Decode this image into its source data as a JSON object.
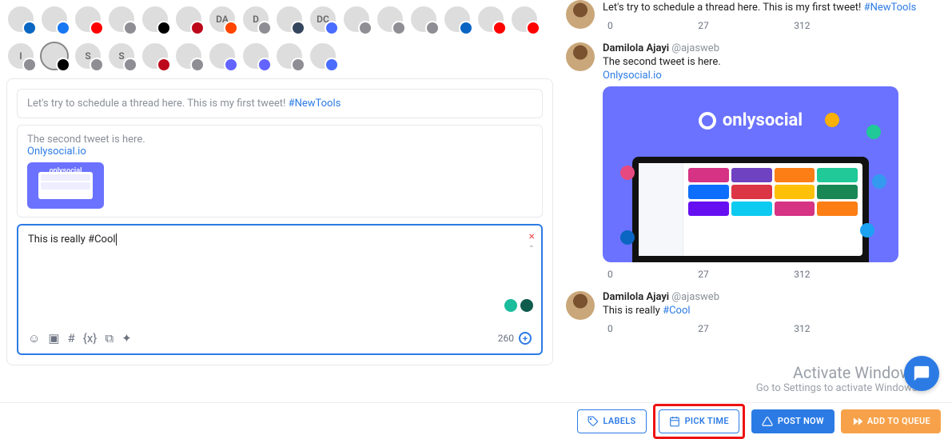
{
  "accounts_row1": [
    {
      "label": "",
      "net": "bg-li"
    },
    {
      "label": "",
      "net": "bg-fb"
    },
    {
      "label": "",
      "net": "bg-yt"
    },
    {
      "label": "",
      "net": "bg-tg"
    },
    {
      "label": "",
      "net": "bg-tk"
    },
    {
      "label": "",
      "net": "bg-pn"
    },
    {
      "label": "DA",
      "net": "bg-rd"
    },
    {
      "label": "D",
      "net": "bg-tg"
    },
    {
      "label": "",
      "net": "bg-tm"
    },
    {
      "label": "DC",
      "net": "bg-bs"
    },
    {
      "label": "",
      "net": "bg-tg"
    },
    {
      "label": "",
      "net": "bg-ig"
    },
    {
      "label": "",
      "net": "bg-ig"
    },
    {
      "label": "",
      "net": "bg-li"
    },
    {
      "label": "",
      "net": "bg-yt"
    },
    {
      "label": "",
      "net": "bg-yt"
    }
  ],
  "accounts_row2": [
    {
      "label": "I",
      "net": "bg-tg",
      "sel": false
    },
    {
      "label": "",
      "net": "bg-x",
      "sel": true
    },
    {
      "label": "S",
      "net": "bg-tg",
      "sel": false
    },
    {
      "label": "S",
      "net": "bg-gray",
      "sel": false
    },
    {
      "label": "",
      "net": "bg-pn",
      "sel": false
    },
    {
      "label": "",
      "net": "bg-tg",
      "sel": false
    },
    {
      "label": "",
      "net": "bg-md",
      "sel": false
    },
    {
      "label": "",
      "net": "bg-md",
      "sel": false
    },
    {
      "label": "",
      "net": "bg-tg",
      "sel": false
    },
    {
      "label": "",
      "net": "bg-bs",
      "sel": false
    }
  ],
  "thread": {
    "p1_text": "Let's try to schedule a thread here. This is my first tweet! ",
    "p1_tag": "#NewTools",
    "p2_text": "The second tweet is here.",
    "p2_link": "Onlysocial.io",
    "p3_text": "This is really ",
    "p3_tag": "#Cool",
    "thumb_brand": "onlysocial"
  },
  "editor": {
    "char_count": "260"
  },
  "preview": {
    "name": "Damilola Ajayi",
    "handle": "@ajasweb",
    "t1_text": "Let's try to schedule a thread here. This is my first tweet! ",
    "t1_tag": "#NewTools",
    "t2_text": "The second tweet is here.",
    "t2_link": "Onlysocial.io",
    "t3_text": "This is really ",
    "t3_tag": "#Cool",
    "brand": "onlysocial",
    "replies": "0",
    "retweets": "27",
    "likes": "312"
  },
  "watermark": {
    "line1": "Activate Windows",
    "line2": "Go to Settings to activate Windows."
  },
  "buttons": {
    "labels": "LABELS",
    "pick_time": "PICK TIME",
    "post_now": "POST NOW",
    "add_queue": "ADD TO QUEUE"
  }
}
